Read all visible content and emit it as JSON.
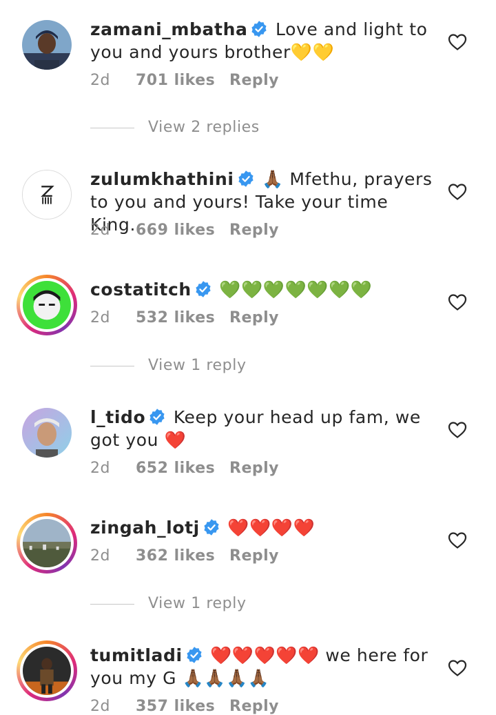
{
  "comments": [
    {
      "username": "zamani_mbatha",
      "text": "Love and light to you and yours brother",
      "emojis": "💛💛",
      "time": "2d",
      "likes": "701 likes",
      "reply": "Reply"
    },
    {
      "username": "zulumkhathini",
      "emojis_lead": "🙏🏾",
      "text": "Mfethu, prayers to you and yours! Take your time King.",
      "time": "2d",
      "likes": "669 likes",
      "reply": "Reply"
    },
    {
      "username": "costatitch",
      "emojis": "💚💚💚💚💚💚💚",
      "time": "2d",
      "likes": "532 likes",
      "reply": "Reply"
    },
    {
      "username": "l_tido",
      "text": "Keep your head up fam, we got you",
      "emojis": "❤️",
      "time": "2d",
      "likes": "652 likes",
      "reply": "Reply"
    },
    {
      "username": "zingah_lotj",
      "emojis": "❤️❤️❤️❤️",
      "time": "2d",
      "likes": "362 likes",
      "reply": "Reply"
    },
    {
      "username": "tumitladi",
      "emojis_lead": "❤️❤️❤️❤️❤️",
      "text": "we here for you my G",
      "emojis": "🙏🏾🙏🏾🙏🏾🙏🏾",
      "time": "2d",
      "likes": "357 likes",
      "reply": "Reply"
    }
  ],
  "view_replies": [
    "View 2 replies",
    "View 1 reply",
    "View 1 reply"
  ],
  "colors": {
    "text": "#262626",
    "secondary": "#8e8e8e",
    "verified": "#3897f0"
  },
  "icons": {
    "verified": "verified-badge-icon",
    "like": "heart-outline-icon"
  }
}
